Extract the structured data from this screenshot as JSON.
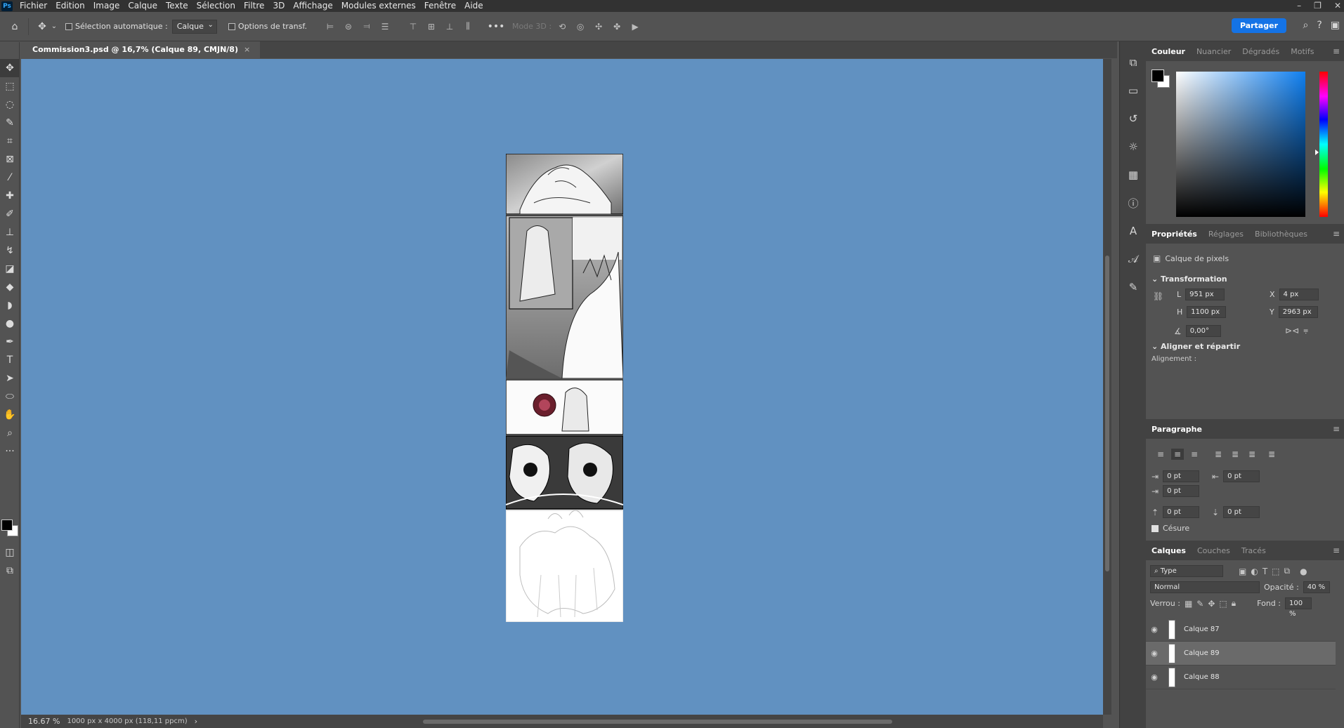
{
  "menu": {
    "logo": "Ps",
    "items": [
      "Fichier",
      "Edition",
      "Image",
      "Calque",
      "Texte",
      "Sélection",
      "Filtre",
      "3D",
      "Affichage",
      "Modules externes",
      "Fenêtre",
      "Aide"
    ]
  },
  "options": {
    "auto_select_label": "Sélection automatique :",
    "auto_select_value": "Calque",
    "transform_label": "Options de transf.",
    "more": "•••",
    "mode3d": "Mode 3D :",
    "share": "Partager"
  },
  "document": {
    "tab_title": "Commission3.psd @ 16,7% (Calque 89, CMJN/8)",
    "zoom": "16.67 %",
    "info": "1000 px x 4000 px (118,11 ppcm)"
  },
  "color_panel": {
    "tabs": [
      "Couleur",
      "Nuancier",
      "Dégradés",
      "Motifs"
    ],
    "active": "Couleur"
  },
  "properties_panel": {
    "tabs": [
      "Propriétés",
      "Réglages",
      "Bibliothèques"
    ],
    "active": "Propriétés",
    "layer_type": "Calque de pixels",
    "transform_title": "Transformation",
    "w_label": "L",
    "w": "951 px",
    "h_label": "H",
    "h": "1100 px",
    "x_label": "X",
    "x": "4 px",
    "y_label": "Y",
    "y": "2963 px",
    "angle": "0,00°",
    "align_title": "Aligner et répartir",
    "align_label": "Alignement :"
  },
  "paragraph_panel": {
    "title": "Paragraphe",
    "indent_left": "0 pt",
    "indent_right": "0 pt",
    "indent_first": "0 pt",
    "space_before": "0 pt",
    "space_after": "0 pt",
    "hyphenation": "Césure"
  },
  "layers_panel": {
    "tabs": [
      "Calques",
      "Couches",
      "Tracés"
    ],
    "active": "Calques",
    "filter": "Type",
    "blend_mode": "Normal",
    "opacity_label": "Opacité :",
    "opacity": "40 %",
    "lock_label": "Verrou :",
    "fill_label": "Fond :",
    "fill": "100 %",
    "layers": [
      {
        "name": "Calque 87",
        "selected": false
      },
      {
        "name": "Calque 89",
        "selected": true
      },
      {
        "name": "Calque 88",
        "selected": false
      }
    ]
  }
}
